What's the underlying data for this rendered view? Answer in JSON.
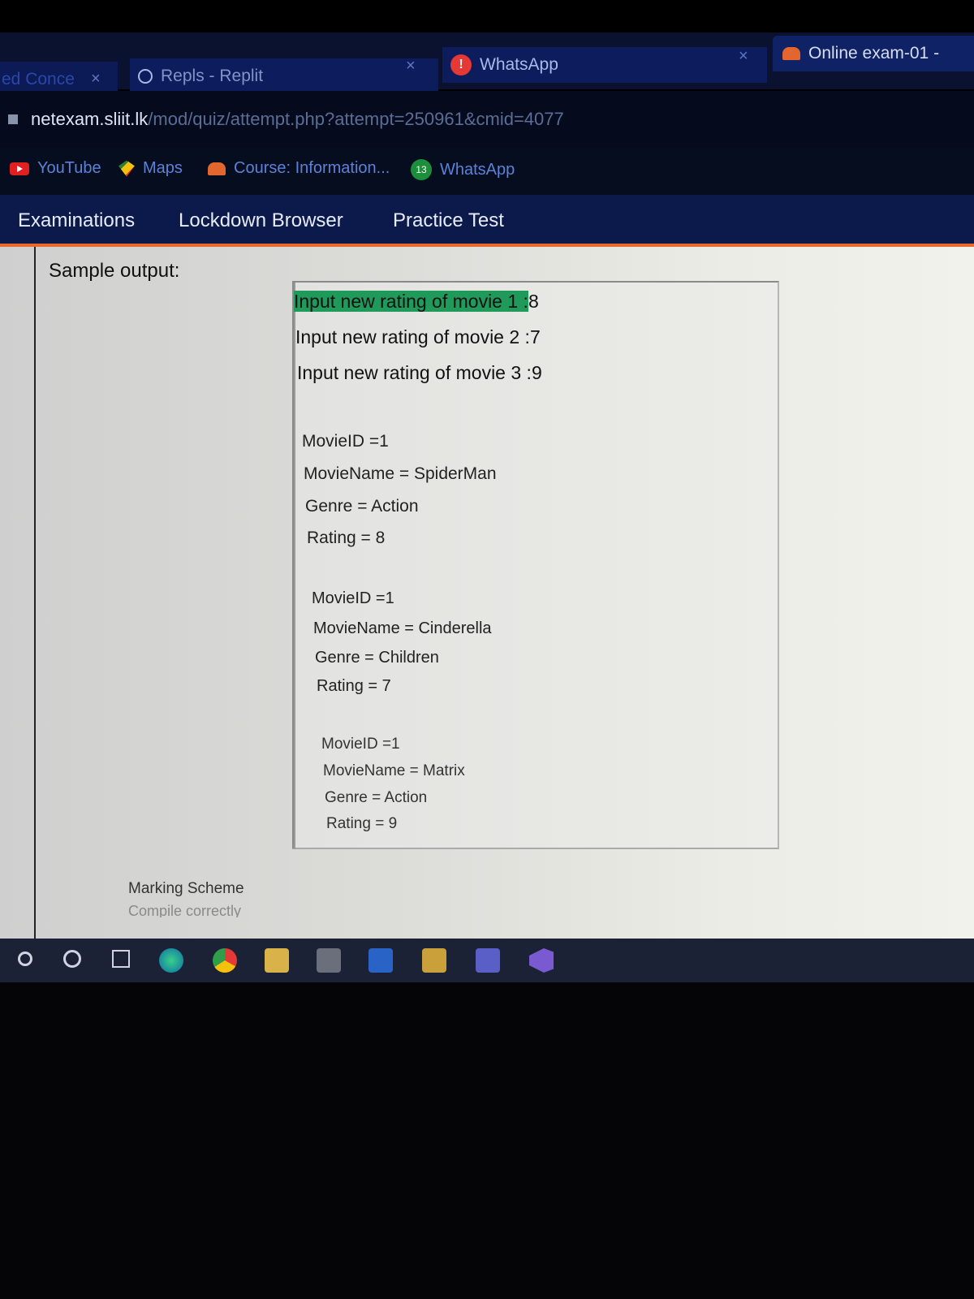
{
  "tabs": [
    {
      "label": "ed Conce",
      "close": "×"
    },
    {
      "label": "Repls - Replit",
      "close": "×",
      "icon": "replit-icon"
    },
    {
      "label": "WhatsApp",
      "close": "×",
      "icon": "whatsapp-icon",
      "badge": "!"
    },
    {
      "label": "Online exam-01 -",
      "icon": "moodle-icon"
    }
  ],
  "address": {
    "host": "netexam.sliit.lk",
    "path": "/mod/quiz/attempt.php?attempt=250961&cmid=4077"
  },
  "bookmarks": [
    {
      "label": "YouTube",
      "icon": "youtube-icon"
    },
    {
      "label": "Maps",
      "icon": "maps-icon"
    },
    {
      "label": "Course: Information...",
      "icon": "moodle-icon"
    },
    {
      "label": "WhatsApp",
      "icon": "whatsapp-icon",
      "badge": "13"
    }
  ],
  "nav": [
    "Examinations",
    "Lockdown Browser",
    "Practice Test"
  ],
  "content": {
    "sample_title": "Sample output:",
    "inputs": [
      {
        "prompt": "Input new rating of movie 1 :",
        "value": "8"
      },
      {
        "prompt": "Input new rating of movie 2 :",
        "value": "7"
      },
      {
        "prompt": "Input new rating of movie 3 :",
        "value": "9"
      }
    ],
    "movies": [
      {
        "id": "MovieID =1",
        "name": "MovieName =  SpiderMan",
        "genre": "Genre = Action",
        "rating": "Rating = 8"
      },
      {
        "id": "MovieID =1",
        "name": "MovieName =  Cinderella",
        "genre": "Genre = Children",
        "rating": "Rating = 7"
      },
      {
        "id": "MovieID =1",
        "name": "MovieName =  Matrix",
        "genre": "Genre = Action",
        "rating": "Rating = 9"
      }
    ],
    "marking_scheme": "Marking Scheme",
    "marking_sub": "Compile correctly"
  },
  "colors": {
    "highlight": "#1f9a5b",
    "nav_bg": "#0b1a4a",
    "nav_accent": "#e86a2a"
  }
}
